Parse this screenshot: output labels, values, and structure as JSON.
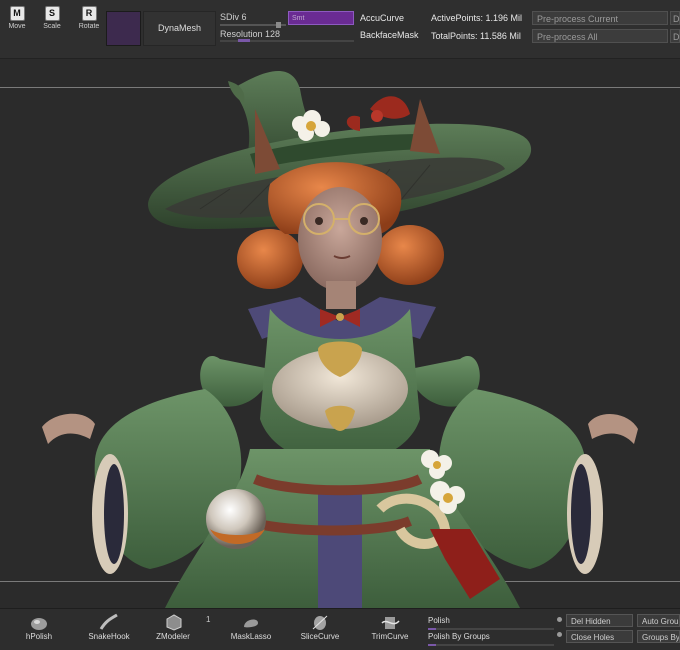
{
  "top_tools": [
    {
      "key": "M",
      "label": "Move"
    },
    {
      "key": "S",
      "label": "Scale"
    },
    {
      "key": "R",
      "label": "Rotate"
    }
  ],
  "dynamesh": {
    "label": "DynaMesh"
  },
  "sdiv": {
    "label": "SDiv 6"
  },
  "smt": {
    "label": "Smt"
  },
  "resolution": {
    "label": "Resolution 128"
  },
  "toggles": {
    "accucurve": "AccuCurve",
    "backfacemask": "BackfaceMask"
  },
  "stats": {
    "active_points": "ActivePoints: 1.196 Mil",
    "total_points": "TotalPoints: 11.586 Mil"
  },
  "buttons": {
    "preprocess_current": "Pre-process Current",
    "preprocess_all": "Pre-process All",
    "edge_top": "D",
    "edge_bottom": "D"
  },
  "bottom_tools": [
    {
      "label": "hPolish"
    },
    {
      "label": "SnakeHook"
    },
    {
      "label": "ZModeler"
    },
    {
      "label": "MaskLasso"
    },
    {
      "label": "SliceCurve"
    },
    {
      "label": "TrimCurve"
    }
  ],
  "zmodeler_count": "1",
  "polish": {
    "label": "Polish",
    "by_groups_label": "Polish By Groups"
  },
  "bottom_buttons": {
    "del_hidden": "Del Hidden",
    "close_holes": "Close Holes",
    "auto_groups": "Auto Grou",
    "groups_by": "Groups By"
  },
  "colors": {
    "accent": "#6a2b93",
    "panel": "#2f2f2f",
    "viewport": "#2b2b2b"
  }
}
